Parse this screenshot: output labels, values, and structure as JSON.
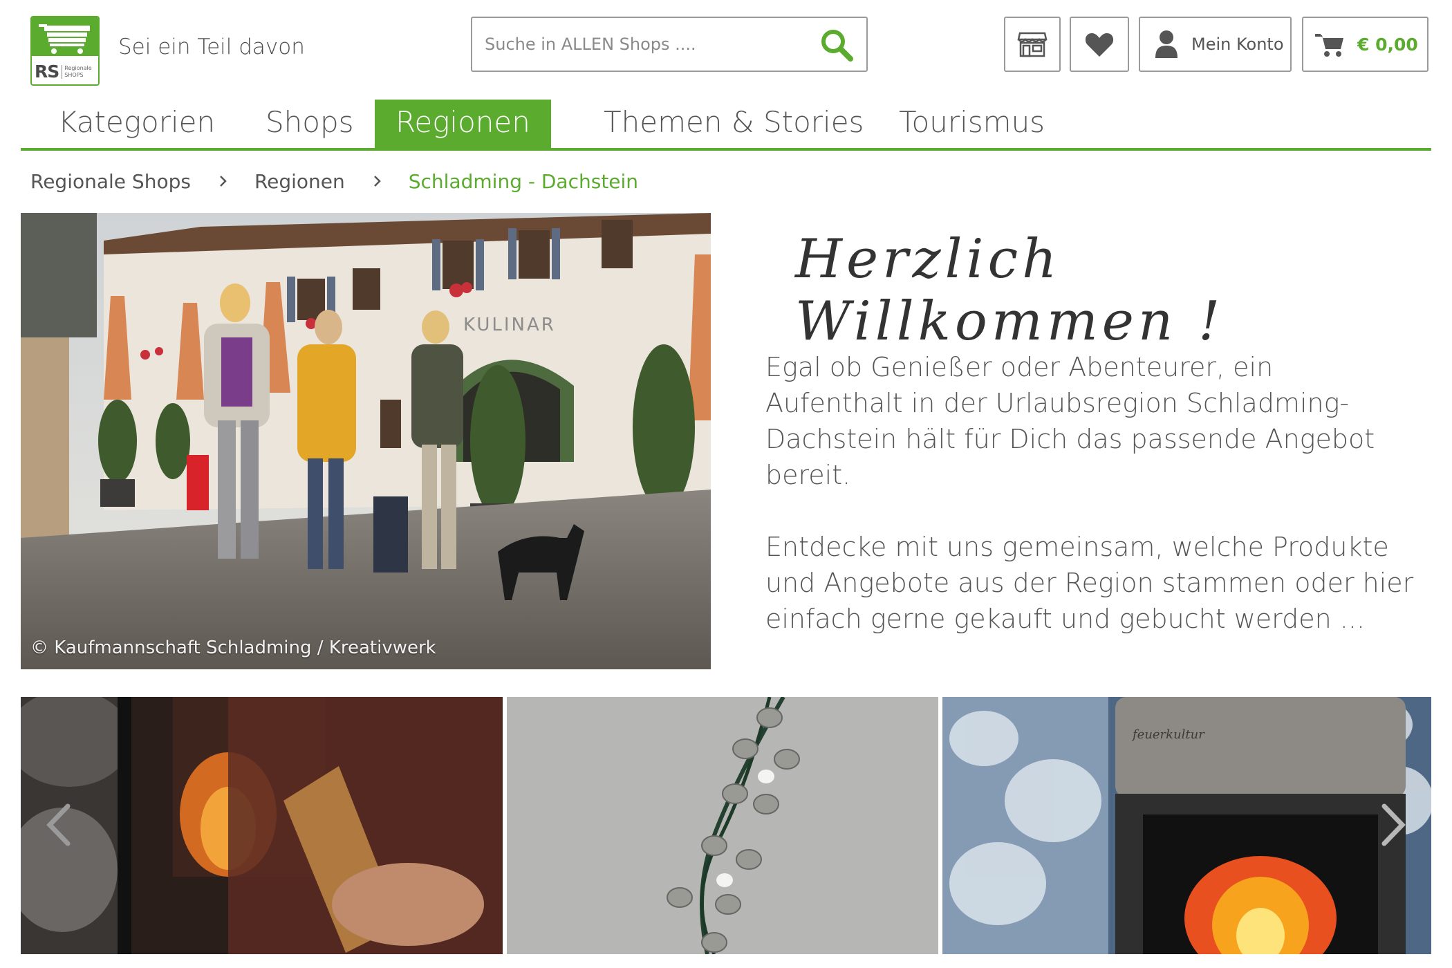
{
  "brand": {
    "logo_text": "RS",
    "logo_small_1": "Regionale",
    "logo_small_2": "SHOPS",
    "tagline": "Sei ein Teil davon",
    "accent_color": "#5aab2e"
  },
  "search": {
    "placeholder": "Suche in ALLEN Shops ...."
  },
  "header_buttons": {
    "store_icon": "storefront-icon",
    "favorites_icon": "heart-icon",
    "account_label": "Mein Konto",
    "cart_amount": "€ 0,00"
  },
  "nav": {
    "items": [
      {
        "label": "Kategorien"
      },
      {
        "label": "Shops"
      },
      {
        "label": "Regionen",
        "active": true
      },
      {
        "label": "Themen & Stories"
      },
      {
        "label": "Tourismus"
      }
    ]
  },
  "breadcrumb": {
    "items": [
      "Regionale Shops",
      "Regionen",
      "Schladming - Dachstein"
    ]
  },
  "hero": {
    "image_credit": "© Kaufmannschaft Schladming / Kreativwerk",
    "welcome": "Herzlich Willkommen !",
    "paragraph_1": "Egal ob Genießer oder Abenteurer, ein Aufenthalt in der Urlaubsregion Schladming-Dachstein hält für Dich das passende Angebot bereit.",
    "paragraph_2": "Entdecke mit uns gemeinsam, welche Produkte und Angebote aus der Region stammen oder hier einfach gerne gekauft und gebucht werden ..."
  },
  "slider": {
    "prev_icon": "chevron-left-icon",
    "next_icon": "chevron-right-icon"
  }
}
